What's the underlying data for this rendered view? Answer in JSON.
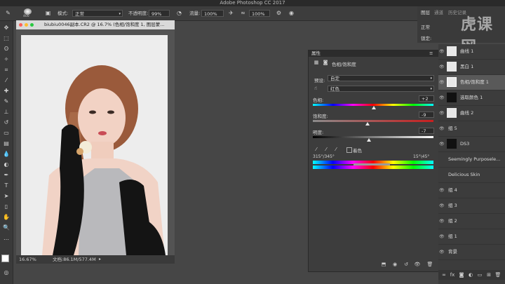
{
  "app": {
    "title": "Adobe Photoshop CC 2017"
  },
  "options_bar": {
    "brush_size": "400",
    "mode_label": "模式:",
    "mode_value": "正常",
    "opacity_label": "不透明度:",
    "opacity_value": "99%",
    "flow_label": "流量:",
    "flow_value": "100%",
    "smooth_value": "100%"
  },
  "document": {
    "title": "biubiu0046副本.CR2 @ 16.7% (色相/饱和度 1, 图层蒙...",
    "zoom": "16.67%",
    "doc_info": "文档:86.1M/577.4M"
  },
  "properties": {
    "panel_title": "属性",
    "adjustment_name": "色相/饱和度",
    "preset_label": "预设:",
    "preset_value": "自定",
    "channel_value": "红色",
    "hue_label": "色相:",
    "hue_value": "+2",
    "saturation_label": "饱和度:",
    "saturation_value": "-9",
    "lightness_label": "明度:",
    "lightness_value": "-7",
    "colorize_label": "着色",
    "range_left": "315°/345°",
    "range_right": "15°\\45°"
  },
  "right_top": {
    "tabs": [
      "图层",
      "通道",
      "历史记录"
    ],
    "label_normal": "正常",
    "label_lock": "锁定:"
  },
  "watermark": {
    "text": "虎课网"
  },
  "layers": [
    {
      "name": "曲线 1"
    },
    {
      "name": "黑白 1"
    },
    {
      "name": "色相/饱和度 1"
    },
    {
      "name": "选取颜色 1"
    },
    {
      "name": "曲线 2"
    },
    {
      "name": "组 5"
    },
    {
      "name": "DS3"
    },
    {
      "name": "Seemingly Purposele..."
    },
    {
      "name": "Delicious Skin"
    },
    {
      "name": "组 4"
    },
    {
      "name": "组 3"
    },
    {
      "name": "组 2"
    },
    {
      "name": "组 1"
    },
    {
      "name": "背景"
    }
  ],
  "colors": {
    "accent": "#2b6bd1",
    "panel_bg": "#3d3d3d",
    "app_bg": "#464646"
  }
}
